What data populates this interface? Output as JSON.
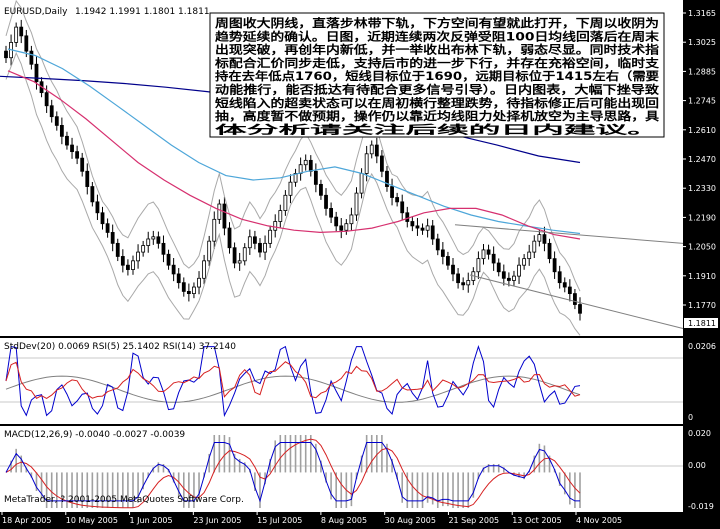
{
  "header": {
    "symbol": "EURUSD,Daily",
    "ohlc": "1.1942 1.1991 1.1801 1.1811"
  },
  "annotation": {
    "lines": [
      "周图收大阴线，直落步林带下轨，下方空间有望就此打开，下周以收阴为",
      "趋势延续的确认。日图，近期连续两次反弹受阻100日均线回落后在周末",
      "出现突破，再创年内新低，并一举收出布林下轨，弱态尽显。同时技术指",
      "标配合汇价同步走低，支持后市的进一步下行，并存在充裕空间，临时支",
      "持在去年低点1760，短线目标位于1690，远期目标位于1415左右（需要",
      "动能推行，能否抵达有待配合更多信号引导）。日内图表，大幅下挫导致",
      "短线陷入的超卖状态可以在周初横行整理跌势，待指标修正后可能出现回",
      "抽，高度暂不做预期，操作仍以靠近均线阻力处择机放空为主导思路，具",
      "体分析请关注后续的日内建议。"
    ]
  },
  "price_axis": {
    "ticks": [
      "1.3165",
      "1.3025",
      "1.2885",
      "1.2745",
      "1.2610",
      "1.2470",
      "1.2330",
      "1.2190",
      "1.2050",
      "1.1910",
      "1.1770"
    ],
    "current_price": "1.1811"
  },
  "indicator1": {
    "label": "StdDev(20) 0.0069  RSI(5) 25.1402  RSI(14) 37.2140",
    "ticks": [
      "0.0206",
      "0"
    ]
  },
  "indicator2": {
    "label": "MACD(12,26,9) -0.0040 -0.0027 -0.0039",
    "ticks": [
      "0.020",
      "0.00",
      "-0.019"
    ]
  },
  "footer": {
    "copyright": "MetaTrader, ? 2001-2005 MetaQuotes Software Corp."
  },
  "time_axis": {
    "ticks": [
      "18 Apr 2005",
      "10 May 2005",
      "1 Jun 2005",
      "23 Jun 2005",
      "15 Jul 2005",
      "8 Aug 2005",
      "30 Aug 2005",
      "21 Sep 2005",
      "13 Oct 2005",
      "4 Nov 2005"
    ]
  },
  "colors": {
    "bull": "#ffffff",
    "bear": "#000000",
    "ma100": "#00008b",
    "ma_mid": "#4da6d9",
    "ma_pink": "#d6306f",
    "bollinger": "#a9a9a9",
    "trendline": "#808080",
    "rsi5": "#0000cd",
    "rsi14": "#d62020",
    "stddev": "#808080",
    "macd_signal": "#d62020",
    "macd_line": "#0000cd",
    "macd_hist": "#a0a0a0"
  },
  "chart_data": [
    {
      "type": "candlestick",
      "title": "EURUSD,Daily",
      "ylim": [
        1.1715,
        1.3235
      ],
      "x_ticks": [
        "18 Apr 2005",
        "10 May 2005",
        "1 Jun 2005",
        "23 Jun 2005",
        "15 Jul 2005",
        "8 Aug 2005",
        "30 Aug 2005",
        "21 Sep 2005",
        "13 Oct 2005",
        "4 Nov 2005"
      ],
      "close_path": [
        1.298,
        1.305,
        1.312,
        1.308,
        1.301,
        1.295,
        1.287,
        1.282,
        1.276,
        1.271,
        1.267,
        1.262,
        1.258,
        1.255,
        1.252,
        1.246,
        1.239,
        1.232,
        1.227,
        1.222,
        1.218,
        1.213,
        1.207,
        1.203,
        1.201,
        1.205,
        1.209,
        1.212,
        1.215,
        1.216,
        1.213,
        1.208,
        1.203,
        1.199,
        1.195,
        1.191,
        1.19,
        1.193,
        1.197,
        1.205,
        1.214,
        1.224,
        1.231,
        1.22,
        1.211,
        1.204,
        1.205,
        1.211,
        1.216,
        1.213,
        1.209,
        1.213,
        1.219,
        1.223,
        1.228,
        1.235,
        1.241,
        1.245,
        1.249,
        1.251,
        1.246,
        1.24,
        1.235,
        1.229,
        1.225,
        1.221,
        1.219,
        1.222,
        1.226,
        1.236,
        1.245,
        1.254,
        1.258,
        1.253,
        1.246,
        1.239,
        1.234,
        1.232,
        1.227,
        1.223,
        1.221,
        1.22,
        1.219,
        1.221,
        1.215,
        1.21,
        1.207,
        1.203,
        1.199,
        1.195,
        1.194,
        1.196,
        1.2,
        1.206,
        1.21,
        1.208,
        1.204,
        1.2,
        1.197,
        1.196,
        1.198,
        1.203,
        1.206,
        1.209,
        1.214,
        1.217,
        1.213,
        1.206,
        1.2,
        1.195,
        1.193,
        1.19,
        1.185,
        1.181
      ],
      "series": [
        {
          "name": "",
          "kind": "ma100",
          "values": [
            1.2895,
            1.2885,
            1.2875,
            1.2862,
            1.2845,
            1.2825,
            1.28,
            1.277,
            1.274,
            1.2705,
            1.2665,
            1.2625,
            1.258,
            1.253,
            1.25
          ]
        },
        {
          "name": "",
          "kind": "ma_mid",
          "values": [
            1.302,
            1.299,
            1.293,
            1.285,
            1.276,
            1.267,
            1.258,
            1.25,
            1.244,
            1.242,
            1.243,
            1.246,
            1.248,
            1.245,
            1.24,
            1.235,
            1.23,
            1.226,
            1.223,
            1.221,
            1.219,
            1.2175
          ]
        },
        {
          "name": "",
          "kind": "ma_pink",
          "values": [
            1.292,
            1.287,
            1.279,
            1.27,
            1.26,
            1.25,
            1.242,
            1.235,
            1.229,
            1.224,
            1.221,
            1.219,
            1.218,
            1.2185,
            1.22,
            1.223,
            1.227,
            1.229,
            1.229,
            1.226,
            1.221,
            1.217,
            1.215
          ]
        }
      ]
    },
    {
      "type": "line",
      "title": "StdDev(20) 0.0069  RSI(5) 25.1402  RSI(14) 37.2140",
      "series": [
        {
          "name": "StdDev(20)",
          "last": 0.0069
        },
        {
          "name": "RSI(5)",
          "last": 25.1402
        },
        {
          "name": "RSI(14)",
          "last": 37.214
        }
      ]
    },
    {
      "type": "bar",
      "title": "MACD(12,26,9) -0.0040 -0.0027 -0.0039",
      "ylim": [
        -0.019,
        0.02
      ],
      "series": [
        {
          "name": "MACD(12,26,9)",
          "last": -0.004
        },
        {
          "name": "",
          "last": -0.0027
        },
        {
          "name": "",
          "last": -0.0039
        }
      ]
    }
  ]
}
